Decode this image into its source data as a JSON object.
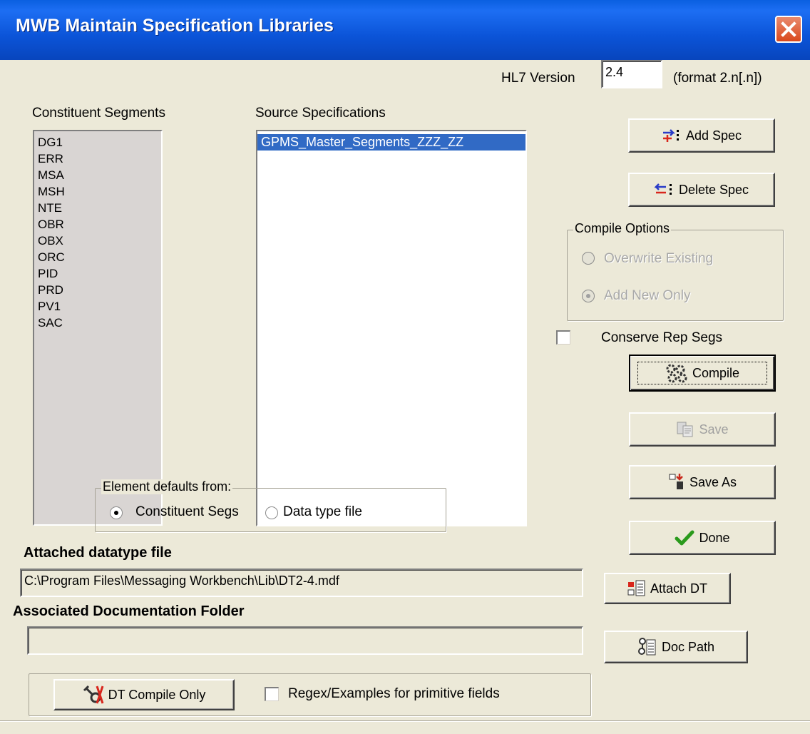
{
  "window": {
    "title": "MWB Maintain Specification Libraries"
  },
  "hl7": {
    "label": "HL7 Version",
    "value": "2.4",
    "format_hint": "(format 2.n[.n])"
  },
  "constituent": {
    "label": "Constituent Segments",
    "items": [
      "DG1",
      "ERR",
      "MSA",
      "MSH",
      "NTE",
      "OBR",
      "OBX",
      "ORC",
      "PID",
      "PRD",
      "PV1",
      "SAC"
    ]
  },
  "source": {
    "label": "Source Specifications",
    "items": [
      "GPMS_Master_Segments_ZZZ_ZZ"
    ]
  },
  "buttons": {
    "add_spec": "Add Spec",
    "delete_spec": "Delete Spec",
    "compile": "Compile",
    "save": "Save",
    "save_as": "Save As",
    "done": "Done",
    "attach_dt": "Attach DT",
    "doc_path": "Doc Path",
    "dt_compile_only": "DT Compile Only"
  },
  "compile_options": {
    "label": "Compile Options",
    "overwrite": "Overwrite Existing",
    "add_new": "Add New Only"
  },
  "conserve": {
    "label": "Conserve Rep Segs"
  },
  "element_defaults": {
    "label": "Element defaults from:",
    "constituent": "Constituent Segs",
    "datatype": "Data type file"
  },
  "attached_datatype": {
    "label": "Attached datatype file",
    "value": "C:\\Program Files\\Messaging Workbench\\Lib\\DT2-4.mdf"
  },
  "doc_folder": {
    "label": "Associated Documentation Folder",
    "value": ""
  },
  "regex": {
    "label": "Regex/Examples for primitive fields"
  },
  "colors": {
    "title_bar": "#0b54d8",
    "selection": "#316ac5",
    "face": "#ece9d8"
  }
}
